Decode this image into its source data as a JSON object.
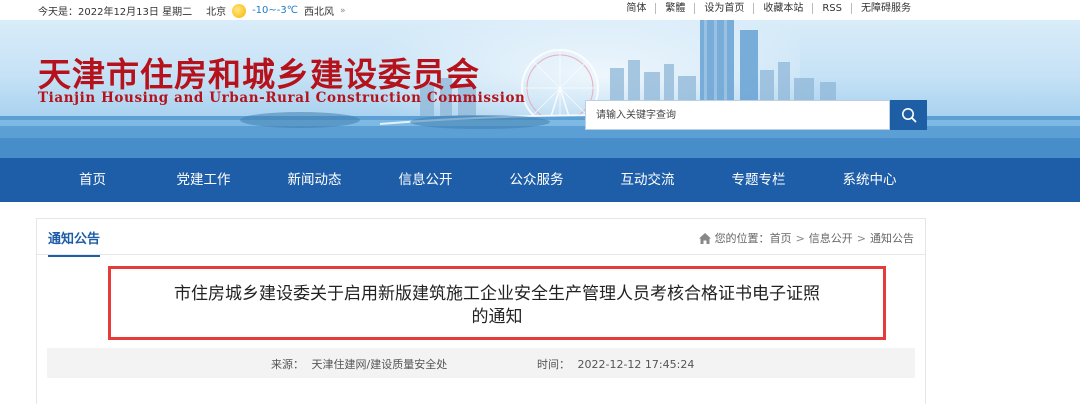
{
  "topbar": {
    "date": "今天是：2022年12月13日 星期二",
    "city": "北京",
    "temp": "-10~-3℃",
    "wind": "西北风",
    "wind_more": "»",
    "links": [
      "简体",
      "繁體",
      "设为首页",
      "收藏本站",
      "RSS",
      "无障碍服务"
    ]
  },
  "banner": {
    "title_cn": "天津市住房和城乡建设委员会",
    "title_en": "Tianjin Housing and Urban-Rural Construction Commission",
    "search_placeholder": "请输入关键字查询"
  },
  "nav": {
    "items": [
      "首页",
      "党建工作",
      "新闻动态",
      "信息公开",
      "公众服务",
      "互动交流",
      "专题专栏",
      "系统中心"
    ]
  },
  "content": {
    "section_title": "通知公告",
    "breadcrumb": {
      "label": "您的位置：",
      "items": [
        "首页",
        "信息公开",
        "通知公告"
      ],
      "separator": ">"
    },
    "headline_line1": "市住房城乡建设委关于启用新版建筑施工企业安全生产管理人员考核合格证书电子证照",
    "headline_line2": "的通知",
    "source_label": "来源：",
    "source_value": "天津住建网/建设质量安全处",
    "time_label": "时间：",
    "time_value": "2022-12-12 17:45:24"
  },
  "colors": {
    "brand_red": "#b5121b",
    "nav_blue": "#1e5ea8",
    "highlight_red": "#e53b3b"
  }
}
